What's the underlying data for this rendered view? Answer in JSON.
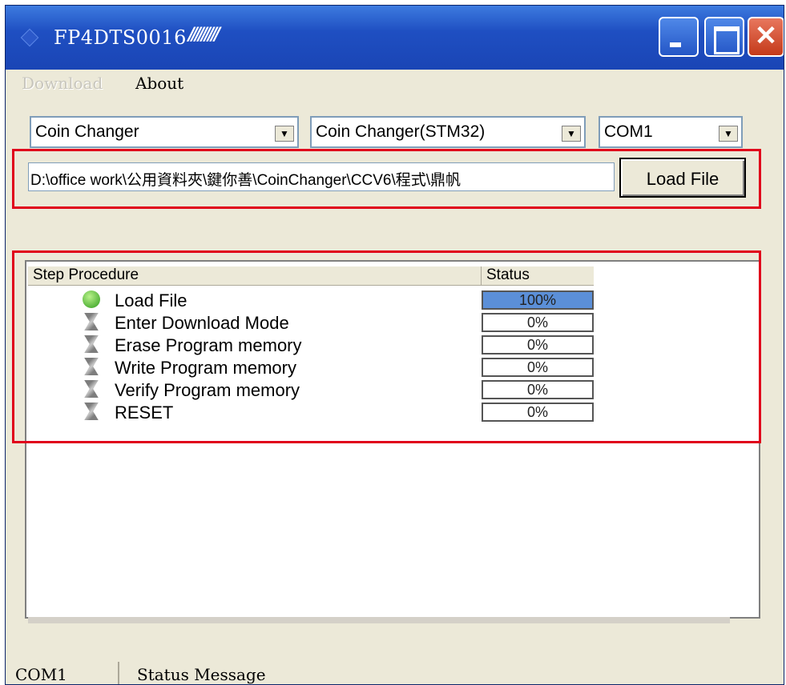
{
  "window": {
    "title": "FP4DTS0016",
    "title_suffix": "/////////"
  },
  "titlebar_buttons": {
    "minimize_icon": "minimize-icon",
    "maximize_icon": "maximize-icon",
    "close_glyph": "✕"
  },
  "menu": {
    "items": [
      {
        "label": "Download",
        "enabled": false
      },
      {
        "label": "About",
        "enabled": true
      }
    ]
  },
  "selectors": {
    "device": {
      "value": "Coin Changer"
    },
    "model": {
      "value": "Coin Changer(STM32)"
    },
    "port": {
      "value": "COM1"
    },
    "arrow_glyph": "▼"
  },
  "file": {
    "path": "D:\\office work\\公用資料夾\\鍵你善\\CoinChanger\\CCV6\\程式\\鼎帆",
    "load_button_label": "Load File"
  },
  "steps_table": {
    "headers": {
      "procedure": "Step Procedure",
      "status": "Status"
    },
    "rows": [
      {
        "label": "Load File",
        "status": "100%",
        "progress": 1.0,
        "icon": "checkmark-icon"
      },
      {
        "label": "Enter Download Mode",
        "status": "0%",
        "progress": 0.0,
        "icon": "hourglass-icon"
      },
      {
        "label": "Erase Program memory",
        "status": "0%",
        "progress": 0.0,
        "icon": "hourglass-icon"
      },
      {
        "label": "Write Program memory",
        "status": "0%",
        "progress": 0.0,
        "icon": "hourglass-icon"
      },
      {
        "label": "Verify Program memory",
        "status": "0%",
        "progress": 0.0,
        "icon": "hourglass-icon"
      },
      {
        "label": "RESET",
        "status": "0%",
        "progress": 0.0,
        "icon": "hourglass-icon"
      }
    ]
  },
  "statusbar": {
    "port": "COM1",
    "message": "Status Message"
  },
  "colors": {
    "highlight": "#e0001b",
    "titlebar": "#1f4fc2",
    "progress_fill": "#5b8fd8"
  }
}
